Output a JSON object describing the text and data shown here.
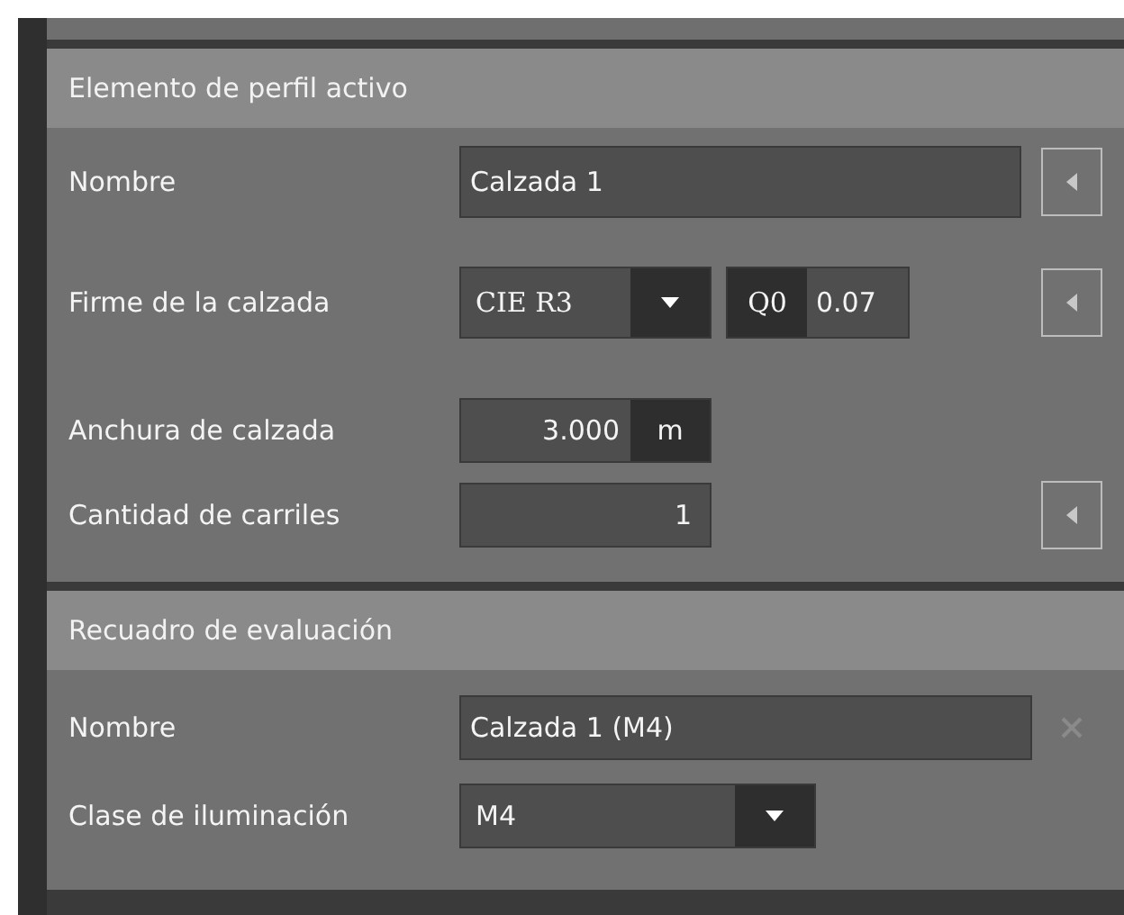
{
  "sections": [
    {
      "title": "Elemento de perfil activo",
      "rows": [
        {
          "kind": "text",
          "label": "Nombre",
          "value": "Calzada 1",
          "side": {
            "kind": "reset"
          }
        },
        {
          "kind": "select-q",
          "label": "Firme de la calzada",
          "value": "CIE R3",
          "q_label": "Q0",
          "q_value": "0.07",
          "side": {
            "kind": "reset"
          }
        },
        {
          "kind": "unit",
          "label": "Anchura de calzada",
          "value": "3.000",
          "unit": "m"
        },
        {
          "kind": "number",
          "label": "Cantidad de carriles",
          "value": "1",
          "side": {
            "kind": "reset"
          }
        }
      ]
    },
    {
      "title": "Recuadro de evaluación",
      "rows": [
        {
          "kind": "text",
          "label": "Nombre",
          "value": "Calzada 1 (M4)",
          "side": {
            "kind": "clear"
          }
        },
        {
          "kind": "select",
          "label": "Clase de iluminación",
          "value": "M4"
        }
      ]
    }
  ]
}
